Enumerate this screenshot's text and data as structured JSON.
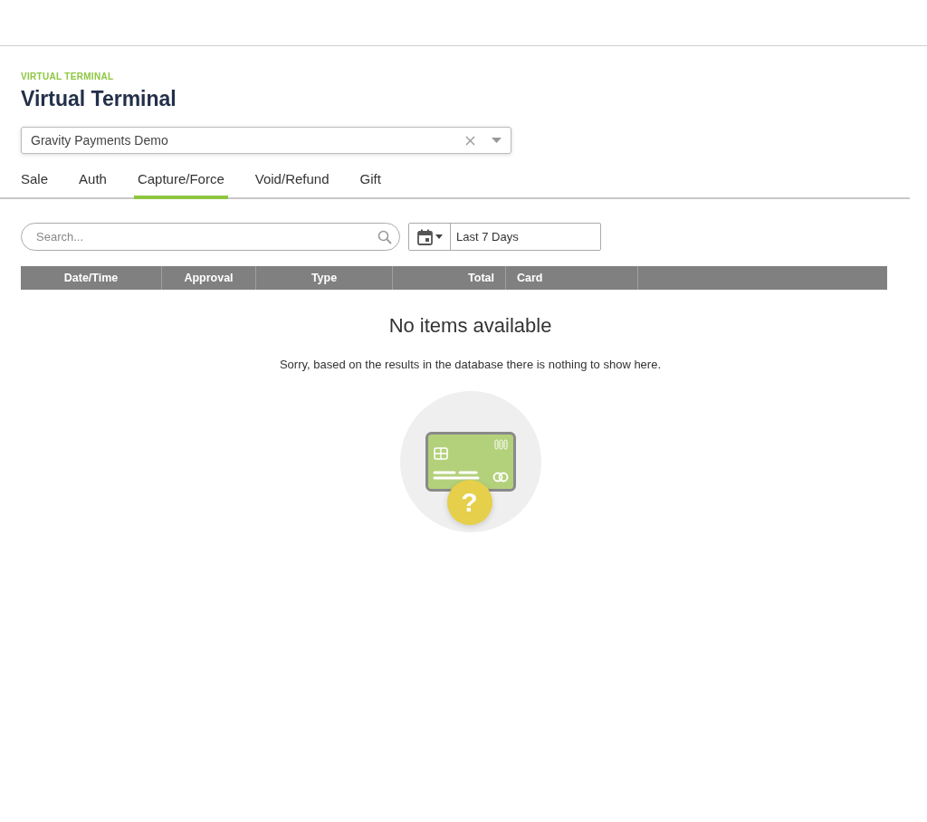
{
  "header": {
    "breadcrumb": "VIRTUAL TERMINAL",
    "title": "Virtual Terminal"
  },
  "merchant_select": {
    "value": "Gravity Payments Demo"
  },
  "tabs": [
    {
      "label": "Sale",
      "selected": false
    },
    {
      "label": "Auth",
      "selected": false
    },
    {
      "label": "Capture/Force",
      "selected": true
    },
    {
      "label": "Void/Refund",
      "selected": false
    },
    {
      "label": "Gift",
      "selected": false
    }
  ],
  "search": {
    "placeholder": "Search..."
  },
  "date_range": {
    "value": "Last 7 Days"
  },
  "table": {
    "columns": [
      "Date/Time",
      "Approval",
      "Type",
      "Total",
      "Card"
    ]
  },
  "empty_state": {
    "title": "No items available",
    "message": "Sorry, based on the results in the database there is nothing to show here.",
    "badge_symbol": "?"
  }
}
